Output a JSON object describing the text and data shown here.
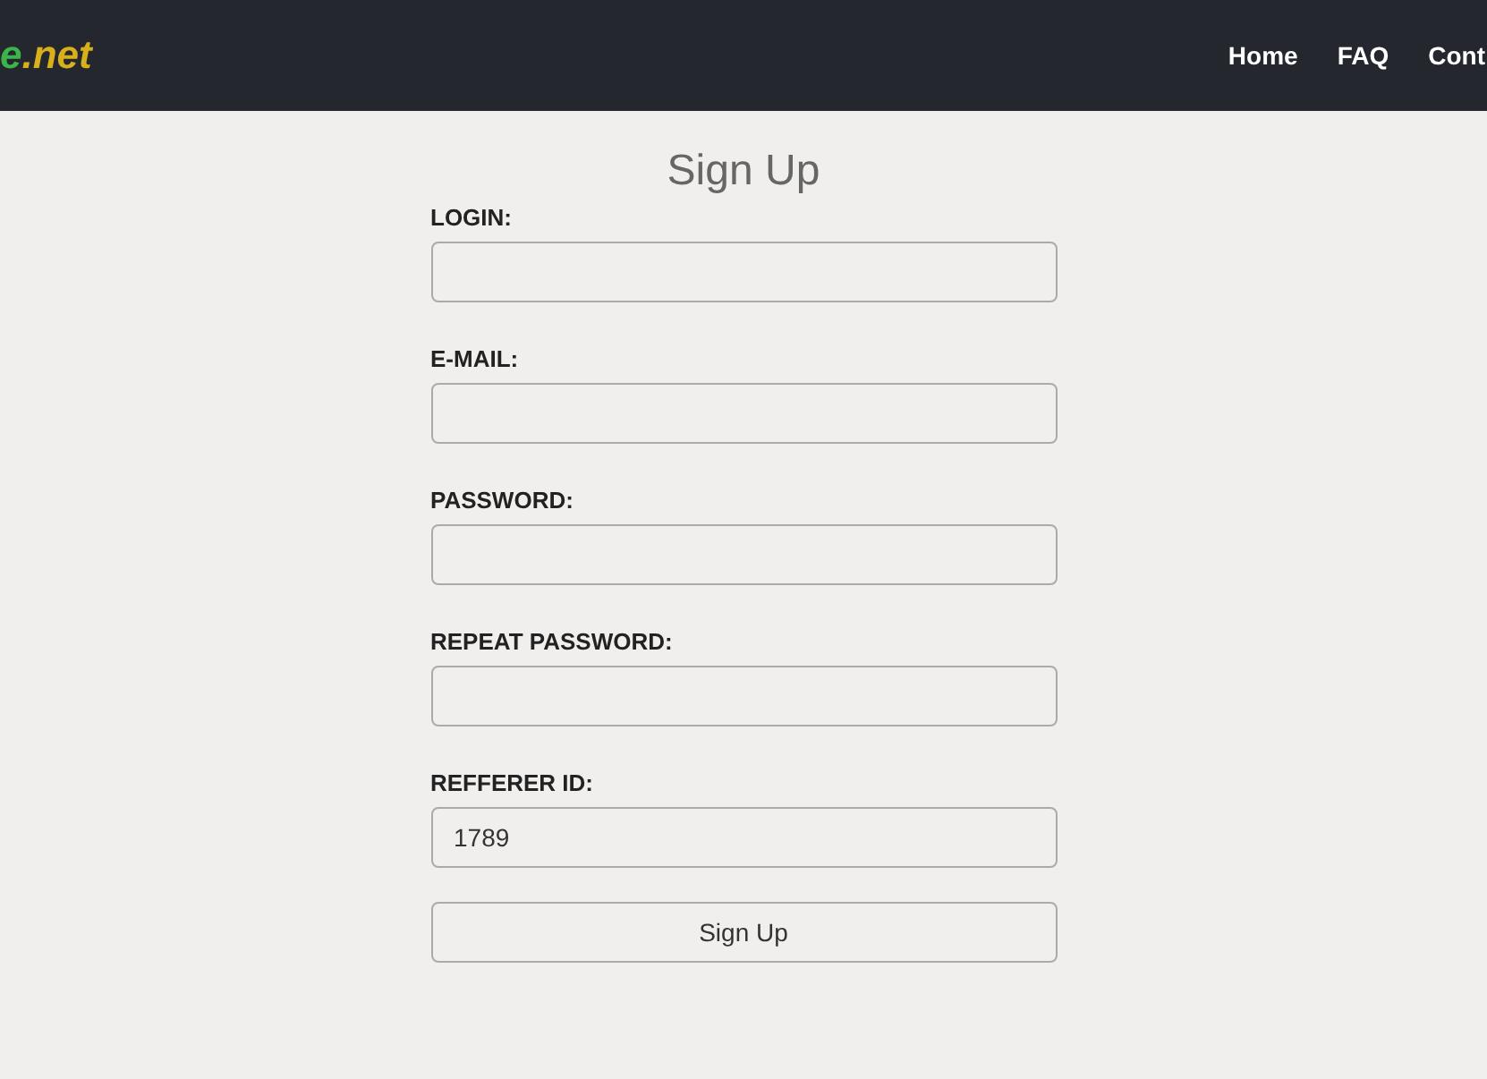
{
  "header": {
    "logo": [
      {
        "text": "e",
        "color": "#3bb54a"
      },
      {
        "text": ".net",
        "color": "#d8b01c"
      }
    ],
    "nav": [
      {
        "label": "Home"
      },
      {
        "label": "FAQ"
      },
      {
        "label": "Cont"
      }
    ]
  },
  "form": {
    "title": "Sign Up",
    "fields": [
      {
        "label": "LOGIN:"
      },
      {
        "label": "E-MAIL:"
      },
      {
        "label": "PASSWORD:"
      },
      {
        "label": "REPEAT PASSWORD:"
      },
      {
        "label": "REFFERER ID:",
        "value": "1789"
      }
    ],
    "submit": "Sign Up"
  }
}
